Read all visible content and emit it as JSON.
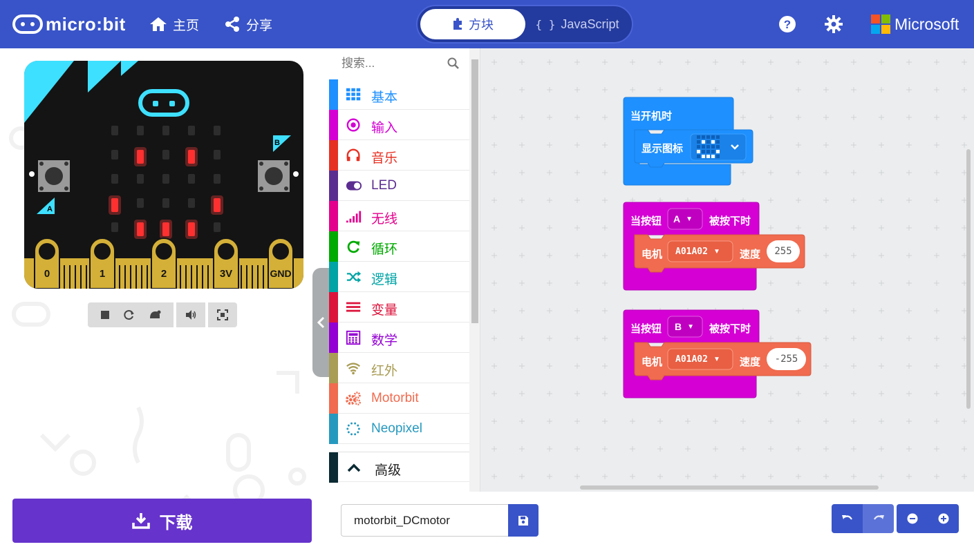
{
  "header": {
    "brand": "micro:bit",
    "nav": {
      "home": "主页",
      "share": "分享"
    },
    "toggle": {
      "blocks": "方块",
      "javascript": "JavaScript"
    },
    "microsoft": "Microsoft"
  },
  "simulator": {
    "pins": [
      "0",
      "1",
      "2",
      "3V",
      "GND"
    ],
    "button_a": "A",
    "button_b": "B",
    "led_pattern": [
      [
        0,
        0,
        0,
        0,
        0
      ],
      [
        0,
        1,
        0,
        1,
        0
      ],
      [
        0,
        0,
        0,
        0,
        0
      ],
      [
        1,
        0,
        0,
        0,
        1
      ],
      [
        0,
        1,
        1,
        1,
        0
      ]
    ],
    "controls": [
      "stop-icon",
      "restart-icon",
      "slowmo-icon",
      "sound-icon",
      "fullscreen-icon"
    ]
  },
  "toolbox": {
    "search_placeholder": "搜索...",
    "categories": [
      {
        "label": "基本",
        "color": "#1e90ff",
        "icon": "grid-icon"
      },
      {
        "label": "输入",
        "color": "#d400d4",
        "icon": "target-icon"
      },
      {
        "label": "音乐",
        "color": "#e63022",
        "icon": "headphones-icon"
      },
      {
        "label": "LED",
        "color": "#5c2d91",
        "icon": "toggle-icon"
      },
      {
        "label": "无线",
        "color": "#e3008c",
        "icon": "signal-icon"
      },
      {
        "label": "循环",
        "color": "#00aa00",
        "icon": "refresh-icon"
      },
      {
        "label": "逻辑",
        "color": "#00a4a6",
        "icon": "shuffle-icon"
      },
      {
        "label": "变量",
        "color": "#dc143c",
        "icon": "lines-icon"
      },
      {
        "label": "数学",
        "color": "#9400d3",
        "icon": "calculator-icon"
      },
      {
        "label": "红外",
        "color": "#a99c55",
        "icon": "wifi-icon"
      },
      {
        "label": "Motorbit",
        "color": "#f06b4f",
        "icon": "gears-icon"
      },
      {
        "label": "Neopixel",
        "color": "#2699bf",
        "icon": "dots-ring-icon"
      }
    ],
    "advanced": "高级"
  },
  "workspace": {
    "start_block": {
      "label": "当开机时",
      "show_icon": "显示图标"
    },
    "button_a_block": {
      "label": "当按钮",
      "button": "A",
      "suffix": "被按下时",
      "motor": "电机",
      "motor_port": "A01A02",
      "speed_label": "速度",
      "speed": "255"
    },
    "button_b_block": {
      "label": "当按钮",
      "button": "B",
      "suffix": "被按下时",
      "motor": "电机",
      "motor_port": "A01A02",
      "speed_label": "速度",
      "speed": "-255"
    },
    "colors": {
      "basic": "#1e90ff",
      "input": "#d400d4",
      "motor": "#f06b4f"
    }
  },
  "footer": {
    "download": "下载",
    "project_name": "motorbit_DCmotor"
  }
}
